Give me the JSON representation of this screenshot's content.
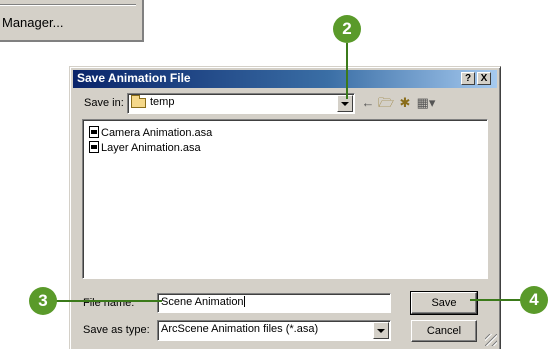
{
  "background_menu": {
    "item_label": "Manager..."
  },
  "dialog": {
    "title": "Save Animation File",
    "titlebar_buttons": {
      "help": "?",
      "close": "X"
    },
    "save_in": {
      "label": "Save in:",
      "value": "temp"
    },
    "toolbar": [
      "back-icon",
      "up-folder-icon",
      "new-folder-icon",
      "view-menu-icon"
    ],
    "files": [
      {
        "name": "Camera Animation.asa"
      },
      {
        "name": "Layer Animation.asa"
      }
    ],
    "file_name": {
      "label": "File name:",
      "value": "Scene Animation"
    },
    "save_as_type": {
      "label": "Save as type:",
      "value": "ArcScene Animation files (*.asa)"
    },
    "buttons": {
      "save": "Save",
      "cancel": "Cancel"
    }
  },
  "callouts": {
    "step2": "2",
    "step3": "3",
    "step4": "4"
  },
  "colors": {
    "callout": "#5a9a2a",
    "titlebar": "#0a246a",
    "dialog": "#d4d0c8"
  }
}
